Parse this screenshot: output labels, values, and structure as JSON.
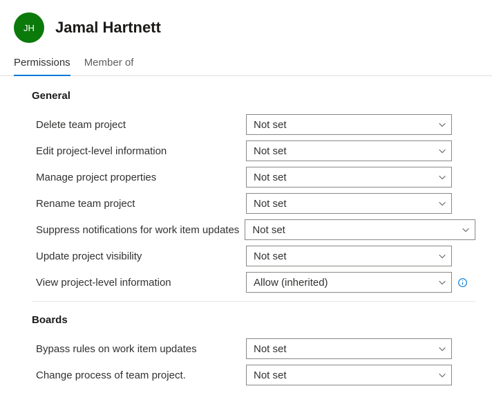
{
  "user": {
    "initials": "JH",
    "name": "Jamal Hartnett"
  },
  "tabs": {
    "permissions": "Permissions",
    "member_of": "Member of"
  },
  "sections": {
    "general": {
      "title": "General",
      "rows": {
        "delete_team_project": {
          "label": "Delete team project",
          "value": "Not set"
        },
        "edit_project_level_info": {
          "label": "Edit project-level information",
          "value": "Not set"
        },
        "manage_project_properties": {
          "label": "Manage project properties",
          "value": "Not set"
        },
        "rename_team_project": {
          "label": "Rename team project",
          "value": "Not set"
        },
        "suppress_notifications": {
          "label": "Suppress notifications for work item updates",
          "value": "Not set"
        },
        "update_project_visibility": {
          "label": "Update project visibility",
          "value": "Not set"
        },
        "view_project_level_info": {
          "label": "View project-level information",
          "value": "Allow (inherited)"
        }
      }
    },
    "boards": {
      "title": "Boards",
      "rows": {
        "bypass_rules": {
          "label": "Bypass rules on work item updates",
          "value": "Not set"
        },
        "change_process": {
          "label": "Change process of team project.",
          "value": "Not set"
        }
      }
    }
  }
}
